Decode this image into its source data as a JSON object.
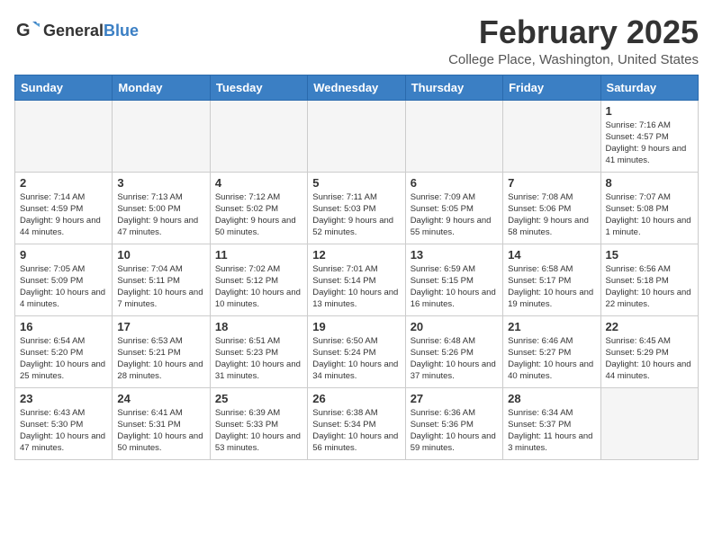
{
  "header": {
    "logo_general": "General",
    "logo_blue": "Blue",
    "month": "February 2025",
    "location": "College Place, Washington, United States"
  },
  "days_of_week": [
    "Sunday",
    "Monday",
    "Tuesday",
    "Wednesday",
    "Thursday",
    "Friday",
    "Saturday"
  ],
  "weeks": [
    [
      {
        "num": "",
        "detail": ""
      },
      {
        "num": "",
        "detail": ""
      },
      {
        "num": "",
        "detail": ""
      },
      {
        "num": "",
        "detail": ""
      },
      {
        "num": "",
        "detail": ""
      },
      {
        "num": "",
        "detail": ""
      },
      {
        "num": "1",
        "detail": "Sunrise: 7:16 AM\nSunset: 4:57 PM\nDaylight: 9 hours\nand 41 minutes."
      }
    ],
    [
      {
        "num": "2",
        "detail": "Sunrise: 7:14 AM\nSunset: 4:59 PM\nDaylight: 9 hours\nand 44 minutes."
      },
      {
        "num": "3",
        "detail": "Sunrise: 7:13 AM\nSunset: 5:00 PM\nDaylight: 9 hours\nand 47 minutes."
      },
      {
        "num": "4",
        "detail": "Sunrise: 7:12 AM\nSunset: 5:02 PM\nDaylight: 9 hours\nand 50 minutes."
      },
      {
        "num": "5",
        "detail": "Sunrise: 7:11 AM\nSunset: 5:03 PM\nDaylight: 9 hours\nand 52 minutes."
      },
      {
        "num": "6",
        "detail": "Sunrise: 7:09 AM\nSunset: 5:05 PM\nDaylight: 9 hours\nand 55 minutes."
      },
      {
        "num": "7",
        "detail": "Sunrise: 7:08 AM\nSunset: 5:06 PM\nDaylight: 9 hours\nand 58 minutes."
      },
      {
        "num": "8",
        "detail": "Sunrise: 7:07 AM\nSunset: 5:08 PM\nDaylight: 10 hours\nand 1 minute."
      }
    ],
    [
      {
        "num": "9",
        "detail": "Sunrise: 7:05 AM\nSunset: 5:09 PM\nDaylight: 10 hours\nand 4 minutes."
      },
      {
        "num": "10",
        "detail": "Sunrise: 7:04 AM\nSunset: 5:11 PM\nDaylight: 10 hours\nand 7 minutes."
      },
      {
        "num": "11",
        "detail": "Sunrise: 7:02 AM\nSunset: 5:12 PM\nDaylight: 10 hours\nand 10 minutes."
      },
      {
        "num": "12",
        "detail": "Sunrise: 7:01 AM\nSunset: 5:14 PM\nDaylight: 10 hours\nand 13 minutes."
      },
      {
        "num": "13",
        "detail": "Sunrise: 6:59 AM\nSunset: 5:15 PM\nDaylight: 10 hours\nand 16 minutes."
      },
      {
        "num": "14",
        "detail": "Sunrise: 6:58 AM\nSunset: 5:17 PM\nDaylight: 10 hours\nand 19 minutes."
      },
      {
        "num": "15",
        "detail": "Sunrise: 6:56 AM\nSunset: 5:18 PM\nDaylight: 10 hours\nand 22 minutes."
      }
    ],
    [
      {
        "num": "16",
        "detail": "Sunrise: 6:54 AM\nSunset: 5:20 PM\nDaylight: 10 hours\nand 25 minutes."
      },
      {
        "num": "17",
        "detail": "Sunrise: 6:53 AM\nSunset: 5:21 PM\nDaylight: 10 hours\nand 28 minutes."
      },
      {
        "num": "18",
        "detail": "Sunrise: 6:51 AM\nSunset: 5:23 PM\nDaylight: 10 hours\nand 31 minutes."
      },
      {
        "num": "19",
        "detail": "Sunrise: 6:50 AM\nSunset: 5:24 PM\nDaylight: 10 hours\nand 34 minutes."
      },
      {
        "num": "20",
        "detail": "Sunrise: 6:48 AM\nSunset: 5:26 PM\nDaylight: 10 hours\nand 37 minutes."
      },
      {
        "num": "21",
        "detail": "Sunrise: 6:46 AM\nSunset: 5:27 PM\nDaylight: 10 hours\nand 40 minutes."
      },
      {
        "num": "22",
        "detail": "Sunrise: 6:45 AM\nSunset: 5:29 PM\nDaylight: 10 hours\nand 44 minutes."
      }
    ],
    [
      {
        "num": "23",
        "detail": "Sunrise: 6:43 AM\nSunset: 5:30 PM\nDaylight: 10 hours\nand 47 minutes."
      },
      {
        "num": "24",
        "detail": "Sunrise: 6:41 AM\nSunset: 5:31 PM\nDaylight: 10 hours\nand 50 minutes."
      },
      {
        "num": "25",
        "detail": "Sunrise: 6:39 AM\nSunset: 5:33 PM\nDaylight: 10 hours\nand 53 minutes."
      },
      {
        "num": "26",
        "detail": "Sunrise: 6:38 AM\nSunset: 5:34 PM\nDaylight: 10 hours\nand 56 minutes."
      },
      {
        "num": "27",
        "detail": "Sunrise: 6:36 AM\nSunset: 5:36 PM\nDaylight: 10 hours\nand 59 minutes."
      },
      {
        "num": "28",
        "detail": "Sunrise: 6:34 AM\nSunset: 5:37 PM\nDaylight: 11 hours\nand 3 minutes."
      },
      {
        "num": "",
        "detail": ""
      }
    ]
  ]
}
